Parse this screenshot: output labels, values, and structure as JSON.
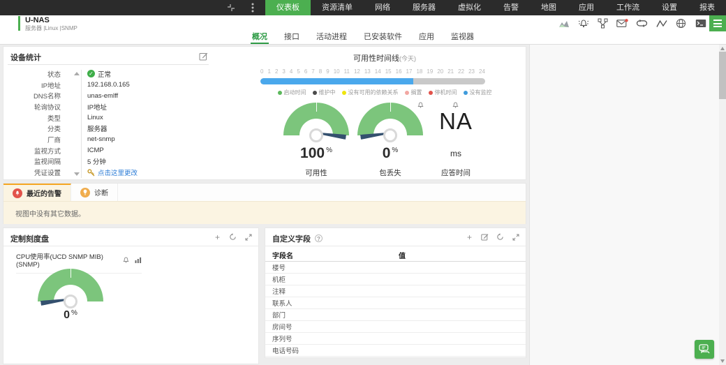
{
  "nav": {
    "items": [
      "仪表板",
      "资源清单",
      "网络",
      "服务器",
      "虚拟化",
      "告警",
      "地图",
      "应用",
      "工作流",
      "设置",
      "报表"
    ]
  },
  "header": {
    "title": "U-NAS",
    "meta": "服务器 |Linux |SNMP"
  },
  "tabs": {
    "items": [
      "概况",
      "接口",
      "活动进程",
      "已安装软件",
      "应用",
      "监视器"
    ]
  },
  "device_stats": {
    "title": "设备统计",
    "rows": [
      {
        "label": "状态",
        "value": "正常"
      },
      {
        "label": "IP地址",
        "value": "192.168.0.165"
      },
      {
        "label": "DNS名称",
        "value": "unas-emlff"
      },
      {
        "label": "轮询协议",
        "value": "IP地址"
      },
      {
        "label": "类型",
        "value": "Linux"
      },
      {
        "label": "分类",
        "value": "服务器"
      },
      {
        "label": "厂商",
        "value": "net-snmp"
      },
      {
        "label": "监视方式",
        "value": "ICMP"
      },
      {
        "label": "监视间隔",
        "value": "5 分钟"
      },
      {
        "label": "凭证设置",
        "value": "点击这里更改"
      }
    ]
  },
  "availability": {
    "title": "可用性时间线",
    "title_suffix": "(今天)",
    "hours": [
      "0",
      "1",
      "2",
      "3",
      "4",
      "5",
      "6",
      "7",
      "8",
      "9",
      "10",
      "11",
      "12",
      "13",
      "14",
      "15",
      "16",
      "17",
      "18",
      "19",
      "20",
      "21",
      "22",
      "23",
      "24"
    ],
    "uptime_percent": 68,
    "legend": [
      {
        "label": "启动时间",
        "color": "#5cb85c"
      },
      {
        "label": "维护中",
        "color": "#4a4a4a"
      },
      {
        "label": "没有可用的依赖关系",
        "color": "#efe50e"
      },
      {
        "label": "搁置",
        "color": "#f2a7a2"
      },
      {
        "label": "停机时间",
        "color": "#e2534b"
      },
      {
        "label": "没有监控",
        "color": "#3f9bdc"
      }
    ],
    "gauges": [
      {
        "value": "100",
        "unit": "%",
        "label": "可用性",
        "percent": 100
      },
      {
        "value": "0",
        "unit": "%",
        "label": "包丢失",
        "percent": 0
      },
      {
        "value": "NA",
        "unit": "ms",
        "label": "应答时间"
      }
    ]
  },
  "alarms": {
    "tab_recent": "最近的告警",
    "tab_diagnostics": "诊断",
    "empty_text": "视图中没有其它数据。"
  },
  "custom_dials": {
    "title": "定制刻度盘",
    "dial": {
      "label": "CPU使用率(UCD SNMP MIB) (SNMP)",
      "value": "0",
      "unit": "%",
      "percent": 0
    }
  },
  "custom_fields": {
    "title": "自定义字段",
    "columns": {
      "name": "字段名",
      "value": "值"
    },
    "rows": [
      "楼号",
      "机柜",
      "注释",
      "联系人",
      "部门",
      "房间号",
      "序列号",
      "电话号码"
    ]
  },
  "colors": {
    "accent_green": "#4caf50",
    "timeline_blue": "#4aa8ec",
    "gauge_green": "#7cc57c",
    "needle": "#34506e",
    "alarm_highlight": "#f5a623"
  }
}
